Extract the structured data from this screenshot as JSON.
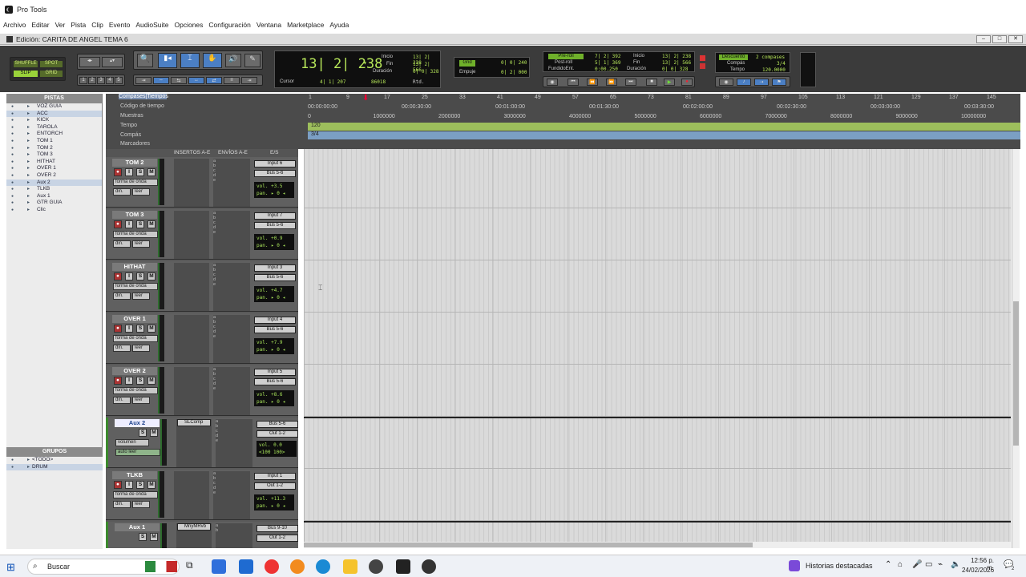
{
  "app": {
    "title": "Pro Tools",
    "window_title": "Edición: CARITA DE ANGEL TEMA 6"
  },
  "menu": [
    "Archivo",
    "Editar",
    "Ver",
    "Pista",
    "Clip",
    "Evento",
    "AudioSuite",
    "Opciones",
    "Configuración",
    "Ventana",
    "Marketplace",
    "Ayuda"
  ],
  "modes": {
    "shuffle": "SHUFFLE",
    "spot": "SPOT",
    "slip": "SLIP",
    "grid": "GRID"
  },
  "zoom_presets": [
    "1",
    "2",
    "3",
    "4",
    "5"
  ],
  "counter": {
    "main": "13| 2| 238",
    "cursor_label": "Cursor",
    "cursor_value": "4| 1| 207",
    "samples": "86018",
    "inicio_label": "Inicio",
    "fin_label": "Fin",
    "duracion_label": "Duración",
    "inicio": "13| 2| 238",
    "fin": "13| 2| 566",
    "duracion": "0| 0| 328",
    "rtd": "Rtd."
  },
  "grid": {
    "grid_label": "Grid",
    "grid_value": "0| 0| 240",
    "nudge_label": "Empuje",
    "nudge_value": "0| 2| 000"
  },
  "transport": {
    "preroll_label": "Pre-roll",
    "postroll_label": "Post-roll",
    "fade_label": "FundidoEnt.",
    "preroll": "7| 2| 392",
    "postroll": "5| 1| 369",
    "fade": "0:00.250",
    "inicio_label": "Inicio",
    "fin_label": "Fin",
    "duracion_label": "Duración",
    "inicio": "13| 2| 238",
    "fin": "13| 2| 566",
    "duracion": "0| 0| 328"
  },
  "countoff": {
    "label": "Descuento",
    "value": "2 compases",
    "meter_label": "Compás",
    "meter": "3/4",
    "tempo_label": "Tempo",
    "tempo": "120.0000"
  },
  "rulers": {
    "bars_label": "Compases|Tiempos",
    "time_label": "Código de tiempo",
    "samples_label": "Muestras",
    "tempo_label": "Tempo",
    "meter_label": "Compás",
    "markers_label": "Marcadores",
    "tempo_marker": "120",
    "meter_marker": "3/4",
    "bars": [
      "1",
      "9",
      "17",
      "25",
      "33",
      "41",
      "49",
      "57",
      "65",
      "73",
      "81",
      "89",
      "97",
      "105",
      "113",
      "121",
      "129",
      "137",
      "145"
    ],
    "timecode": [
      "00:00:00:00",
      "00:00:30:00",
      "00:01:00:00",
      "00:01:30:00",
      "00:02:00:00",
      "00:02:30:00",
      "00:03:00:00",
      "00:03:30:00"
    ],
    "samples": [
      "0",
      "1000000",
      "2000000",
      "3000000",
      "4000000",
      "5000000",
      "6000000",
      "7000000",
      "8000000",
      "9000000",
      "10000000"
    ]
  },
  "panels": {
    "tracks_header": "PISTAS",
    "groups_header": "GRUPOS"
  },
  "track_list": [
    "VOZ GUIA",
    "ACC",
    "KICK",
    "TAROLA",
    "ENTORCH",
    "TOM 1",
    "TOM 2",
    "TOM 3",
    "HITHAT",
    "OVER 1",
    "OVER 2",
    "Aux 2",
    "TLKB",
    "Aux 1",
    "GTR GUIA",
    "Clic"
  ],
  "groups": [
    "<TODO>",
    "DRUM"
  ],
  "columns": {
    "inserts": "INSERTOS A-E",
    "sends": "ENVÍOS A-E",
    "io": "E/S"
  },
  "track_strings": {
    "waveform": "forma de onda",
    "dyn": "din.",
    "read": "leer",
    "vol": "vol.",
    "pan": "pan.",
    "volume_view": "volumen",
    "auto_read": "auto leer",
    "send_slots": [
      "a",
      "b",
      "c",
      "d",
      "e"
    ]
  },
  "tracks": [
    {
      "name": "TOM 2",
      "input": "Input 6",
      "output": "Bus 5-6",
      "vol": "+3.5",
      "pan": "▸ 0 ◂"
    },
    {
      "name": "TOM 3",
      "input": "Input 7",
      "output": "Bus 5-6",
      "vol": "+0.9",
      "pan": "▸ 0 ◂"
    },
    {
      "name": "HITHAT",
      "input": "Input 3",
      "output": "Bus 5-6",
      "vol": "+4.7",
      "pan": "▸ 0 ◂"
    },
    {
      "name": "OVER 1",
      "input": "Input 4",
      "output": "Bus 5-6",
      "vol": "+7.9",
      "pan": "▸ 0 ◂"
    },
    {
      "name": "OVER 2",
      "input": "Input 5",
      "output": "Bus 5-6",
      "vol": "+8.6",
      "pan": "▸ 0 ◂"
    },
    {
      "name": "Aux 2",
      "input": "Bus 5-6",
      "output": "Out 1-2",
      "vol": "0.0",
      "pan": "<100  100>",
      "insert": "SLComp"
    },
    {
      "name": "TLKB",
      "input": "Input 1",
      "output": "Out 1-2",
      "vol": "+11.3",
      "pan": "▸ 0 ◂"
    },
    {
      "name": "Aux 1",
      "input": "Bus 9-10",
      "output": "Out 1-2",
      "insert": "MnyMRvb"
    }
  ],
  "taskbar": {
    "search": "Buscar",
    "news": "Historias destacadas",
    "time": "12:56 p. m.",
    "date": "24/02/2026",
    "notif": "2"
  }
}
